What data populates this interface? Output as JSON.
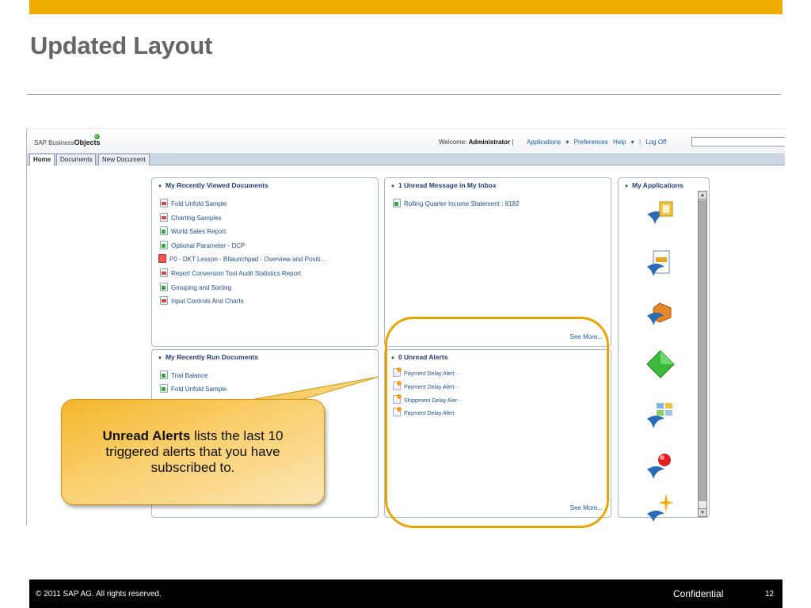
{
  "slide": {
    "title": "Updated Layout",
    "footer": {
      "copyright_symbol": "©",
      "copyright": "2011 SAP AG. All rights reserved.",
      "classification": "Confidential",
      "page_number": "12"
    },
    "accent_color": "#f0ab00"
  },
  "app": {
    "logo": {
      "prefix": "SAP Business",
      "bold": "Objects"
    },
    "welcome_label": "Welcome:",
    "user": "Administrator",
    "menu": {
      "applications": "Applications",
      "preferences": "Preferences",
      "help": "Help",
      "log_off": "Log Off"
    },
    "search_value": "",
    "tabs": [
      {
        "label": "Home"
      },
      {
        "label": "Documents"
      },
      {
        "label": "New Document"
      }
    ],
    "panels": {
      "recently_viewed": {
        "title": "My Recently Viewed Documents",
        "items": [
          {
            "label": "Fold Unfold Sample",
            "icon": "webi-report-icon"
          },
          {
            "label": "Charting Samples",
            "icon": "webi-report-icon"
          },
          {
            "label": "World Sales Report",
            "icon": "crystal-report-icon"
          },
          {
            "label": "Optional Parameter - DCP",
            "icon": "crystal-report-icon"
          },
          {
            "label": "P0 - DKT Lesson - BIlaunchpad - Overview and Positi…",
            "icon": "pdf-icon"
          },
          {
            "label": "Report Conversion Tool Audit Statistics Report",
            "icon": "webi-report-icon"
          },
          {
            "label": "Grouping and Sorting",
            "icon": "crystal-report-icon"
          },
          {
            "label": "Input Controls And Charts",
            "icon": "webi-report-icon"
          }
        ]
      },
      "inbox": {
        "title": "1 Unread Message in My Inbox",
        "items": [
          {
            "label": "Rolling Quarter Income Statement : 8182",
            "icon": "crystal-report-icon"
          }
        ],
        "see_more": "See More..."
      },
      "recently_run": {
        "title": "My Recently Run Documents",
        "items": [
          {
            "label": "Trial Balance",
            "icon": "crystal-report-icon"
          },
          {
            "label": "Fold Unfold Sample",
            "icon": "crystal-report-icon"
          }
        ]
      },
      "alerts": {
        "title": "0 Unread Alerts",
        "items": [
          {
            "label": "Payment Delay Alert···",
            "icon": "alert-icon"
          },
          {
            "label": "Payment Delay Alert···",
            "icon": "alert-icon"
          },
          {
            "label": "Shippment Delay Aler···",
            "icon": "alert-icon"
          },
          {
            "label": "Payment Delay Alert",
            "icon": "alert-icon"
          }
        ],
        "see_more": "See More..."
      },
      "applications": {
        "title": "My Applications",
        "icons": [
          "cmc-icon",
          "web-intelligence-icon",
          "explorer-icon",
          "dashboard-icon",
          "bi-workspace-icon",
          "pinpoint-icon",
          "star-icon"
        ]
      }
    }
  },
  "callout": {
    "bold": "Unread Alerts",
    "text": " lists the last 10 triggered alerts that you have subscribed to."
  }
}
